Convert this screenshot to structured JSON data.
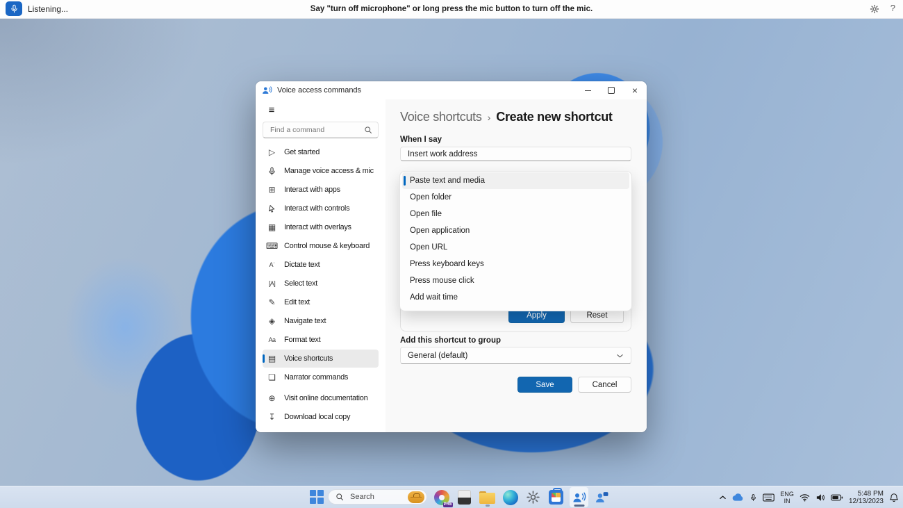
{
  "voice_bar": {
    "status": "Listening...",
    "message": "Say \"turn off microphone\" or long press the mic button to turn off the mic.",
    "help_label": "?"
  },
  "window": {
    "title": "Voice access commands",
    "controls": {
      "close_glyph": "×"
    },
    "sidebar": {
      "menu_icon": "≡",
      "search_placeholder": "Find a command",
      "items": [
        {
          "label": "Get started",
          "icon": "play-icon",
          "glyph": "▷"
        },
        {
          "label": "Manage voice access & mic",
          "icon": "mic-icon"
        },
        {
          "label": "Interact with apps",
          "icon": "apps-grid-icon",
          "glyph": "⊞"
        },
        {
          "label": "Interact with controls",
          "icon": "cursor-icon"
        },
        {
          "label": "Interact with overlays",
          "icon": "overlays-grid-icon",
          "glyph": "▦"
        },
        {
          "label": "Control mouse & keyboard",
          "icon": "mouse-keyboard-icon",
          "glyph": "⌨"
        },
        {
          "label": "Dictate text",
          "icon": "dictate-text-icon",
          "glyph": "Aˈ"
        },
        {
          "label": "Select text",
          "icon": "select-text-icon",
          "glyph": "[A]"
        },
        {
          "label": "Edit text",
          "icon": "edit-text-icon",
          "glyph": "✎"
        },
        {
          "label": "Navigate text",
          "icon": "navigate-text-icon",
          "glyph": "◈"
        },
        {
          "label": "Format text",
          "icon": "format-text-icon",
          "glyph": "Aa"
        },
        {
          "label": "Voice shortcuts",
          "icon": "voice-shortcuts-icon",
          "glyph": "▤",
          "selected": true
        },
        {
          "label": "Narrator commands",
          "icon": "narrator-icon",
          "glyph": "❏"
        }
      ],
      "footer_items": [
        {
          "label": "Visit online documentation",
          "icon": "globe-icon",
          "glyph": "⊕"
        },
        {
          "label": "Download local copy",
          "icon": "download-icon",
          "glyph": "↧"
        }
      ]
    },
    "breadcrumb": {
      "parent": "Voice shortcuts",
      "separator": "›",
      "current": "Create new shortcut"
    },
    "form": {
      "when_label": "When I say",
      "when_value": "Insert work address",
      "menu_items": [
        {
          "label": "Paste text and media",
          "selected": true
        },
        {
          "label": "Open folder"
        },
        {
          "label": "Open file"
        },
        {
          "label": "Open application"
        },
        {
          "label": "Open URL"
        },
        {
          "label": "Press keyboard keys"
        },
        {
          "label": "Press mouse click"
        },
        {
          "label": "Add wait time"
        }
      ],
      "apply_label": "Apply",
      "reset_label": "Reset",
      "group_label": "Add this shortcut to group",
      "group_value": "General (default)",
      "save_label": "Save",
      "cancel_label": "Cancel"
    }
  },
  "taskbar": {
    "search_placeholder": "Search",
    "paint_badge": "PRE",
    "apps": [
      "paint",
      "notepad",
      "file-explorer",
      "edge",
      "settings",
      "store",
      "voice-access",
      "people-chat"
    ],
    "tray": {
      "language_top": "ENG",
      "language_bottom": "IN",
      "time": "5:48 PM",
      "date": "12/13/2023"
    }
  },
  "colors": {
    "accent": "#0067c0",
    "button_blue": "#1266b0",
    "mic_button": "#1a66c4"
  }
}
